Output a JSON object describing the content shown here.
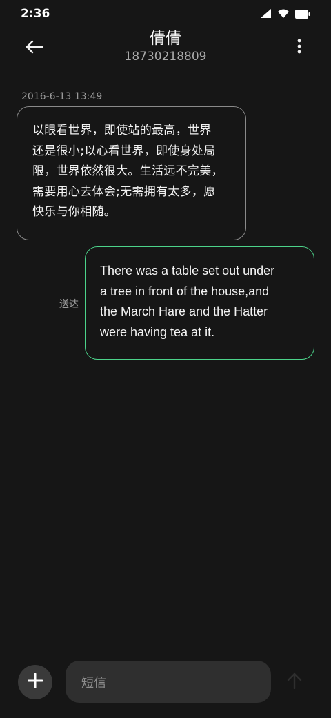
{
  "status_bar": {
    "time": "2:36",
    "icons": [
      "signal-icon",
      "wifi-icon",
      "battery-icon"
    ]
  },
  "header": {
    "back_icon": "arrow-left-icon",
    "contact_name": "倩倩",
    "contact_number": "18730218809",
    "more_icon": "more-vertical-icon"
  },
  "conversation": {
    "timestamp": "2016-6-13 13:49",
    "incoming": {
      "lines": [
        "以眼看世界，即使站的最高，世界",
        "还是很小;以心看世界，即使身处局",
        "限，世界依然很大。生活远不完美，",
        "需要用心去体会;无需拥有太多，愿",
        "快乐与你相随。"
      ]
    },
    "outgoing": {
      "status": "送达",
      "lines": [
        "There was a table set out under",
        "a tree in front of the house,and",
        "the March Hare and the Hatter",
        "were having tea at it."
      ]
    }
  },
  "composer": {
    "add_icon": "plus-icon",
    "placeholder": "短信",
    "send_icon": "send-arrow-icon"
  },
  "colors": {
    "background": "#161616",
    "incoming_border": "#8a8a8a",
    "outgoing_border": "#4cd38a",
    "input_bg": "#2f2f2f",
    "add_button_bg": "#3a3a3a"
  }
}
